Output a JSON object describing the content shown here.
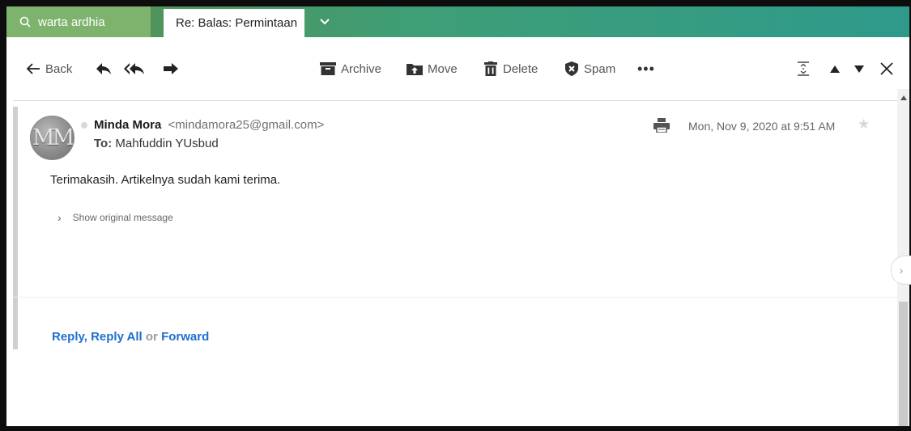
{
  "tabs": {
    "search_label": "warta ardhia",
    "active_label": "Re: Balas: Permintaan"
  },
  "toolbar": {
    "back_label": "Back",
    "archive_label": "Archive",
    "move_label": "Move",
    "delete_label": "Delete",
    "spam_label": "Spam",
    "more_label": "•••",
    "close_label": "✕"
  },
  "message": {
    "avatar_initials": "MM",
    "sender_name": "Minda Mora",
    "sender_email": "<mindamora25@gmail.com>",
    "to_label": "To:",
    "to_name": "Mahfuddin YUsbud",
    "date": "Mon, Nov 9, 2020 at 9:51 AM",
    "body": "Terimakasih. Artikelnya sudah kami terima.",
    "show_original": "Show original message"
  },
  "reply_bar": {
    "reply": "Reply",
    "comma": ",",
    "reply_all": "Reply All",
    "or": "or",
    "forward": "Forward"
  },
  "colors": {
    "tab_green": "#7eb36d",
    "accent_link": "#1f6fd1"
  }
}
